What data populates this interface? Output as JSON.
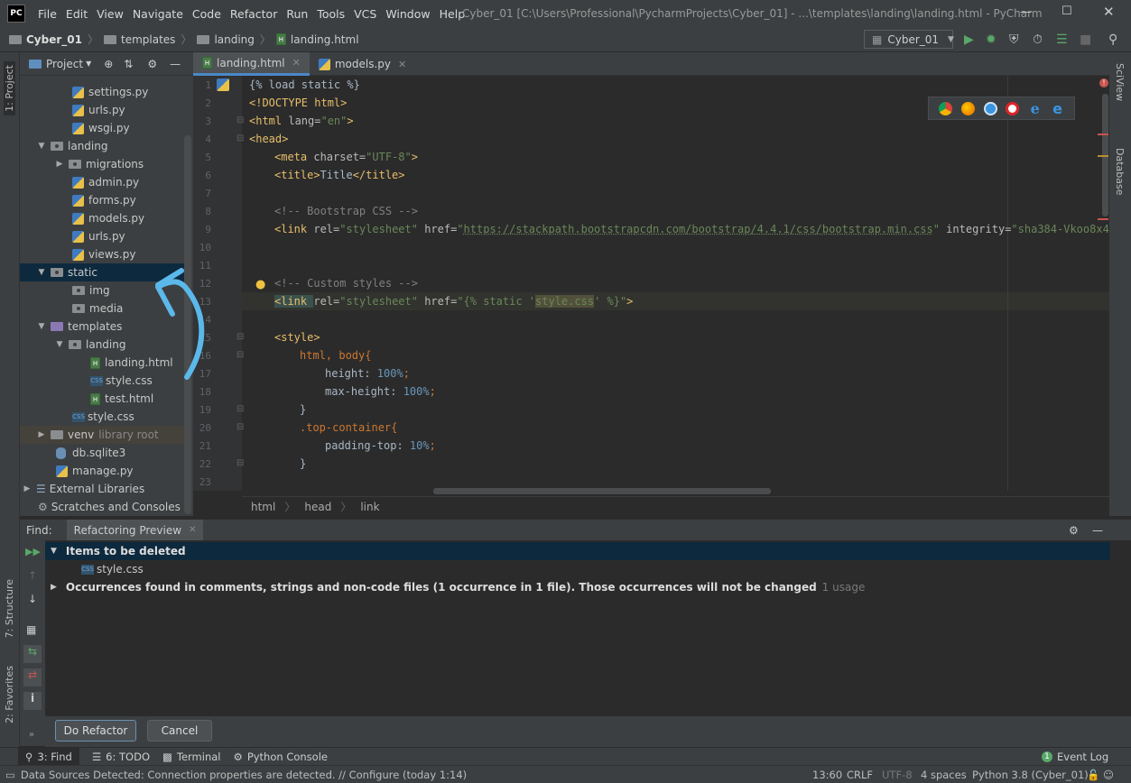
{
  "menu": {
    "logo": "PC",
    "items": [
      "File",
      "Edit",
      "View",
      "Navigate",
      "Code",
      "Refactor",
      "Run",
      "Tools",
      "VCS",
      "Window",
      "Help"
    ]
  },
  "window_title": "Cyber_01 [C:\\Users\\Professional\\PycharmProjects\\Cyber_01] - ...\\templates\\landing\\landing.html - PyCharm",
  "nav": {
    "breadcrumbs": [
      "Cyber_01",
      "templates",
      "landing",
      "landing.html"
    ],
    "run_config": "Cyber_01"
  },
  "left_tools": {
    "project": "1: Project",
    "structure": "7: Structure",
    "favorites": "2: Favorites"
  },
  "right_tools": {
    "sciview": "SciView",
    "database": "Database"
  },
  "project": {
    "header": "Project",
    "tree": [
      "settings.py",
      "urls.py",
      "wsgi.py",
      "landing",
      "migrations",
      "admin.py",
      "forms.py",
      "models.py",
      "urls.py",
      "views.py",
      "static",
      "img",
      "media",
      "templates",
      "landing",
      "landing.html",
      "style.css",
      "test.html",
      "style.css",
      "venv",
      "db.sqlite3",
      "manage.py",
      "External Libraries",
      "Scratches and Consoles"
    ],
    "venv_suffix": "library root"
  },
  "tabs": [
    "landing.html",
    "models.py"
  ],
  "code": {
    "line_numbers": [
      "1",
      "2",
      "3",
      "4",
      "5",
      "6",
      "7",
      "8",
      "9",
      "10",
      "11",
      "12",
      "13",
      "14",
      "15",
      "16",
      "17",
      "18",
      "19",
      "20",
      "21",
      "22",
      "23"
    ],
    "l1": "{% load static %}",
    "l2": "<!DOCTYPE html>",
    "l3a": "<html ",
    "l3b": "lang=",
    "l3c": "\"en\"",
    "l3d": ">",
    "l4": "<head>",
    "l5a": "<meta ",
    "l5b": "charset=",
    "l5c": "\"UTF-8\"",
    "l5d": ">",
    "l6a": "<title>",
    "l6b": "Title",
    "l6c": "</title>",
    "l8": "<!-- Bootstrap CSS -->",
    "l9a": "<link ",
    "l9b": "rel=",
    "l9c": "\"stylesheet\" ",
    "l9d": "href=",
    "l9e": "\"",
    "l9f": "https://stackpath.bootstrapcdn.com/bootstrap/4.4.1/css/bootstrap.min.css",
    "l9g": "\" ",
    "l9h": "integrity=",
    "l9i": "\"sha384-Vkoo8x4CGsO3",
    "l12": "<!-- Custom styles -->",
    "l13a": "<link ",
    "l13b": "rel=",
    "l13c": "\"stylesheet\" ",
    "l13d": "href=",
    "l13e": "\"{% static '",
    "l13f": "style.css",
    "l13g": "' %}\"",
    "l13h": ">",
    "l15": "<style>",
    "l16": "html, body{",
    "l17a": "height: ",
    "l17b": "100%",
    "l17c": ";",
    "l18a": "max-height: ",
    "l18b": "100%",
    "l18c": ";",
    "l19": "}",
    "l20": ".top-container{",
    "l21a": "padding-top: ",
    "l21b": "10%",
    "l21c": ";",
    "l22": "}"
  },
  "editor_breadcrumb": [
    "html",
    "head",
    "link"
  ],
  "find": {
    "label": "Find:",
    "tab": "Refactoring Preview",
    "rows": {
      "deleted": "Items to be deleted",
      "file": "style.css",
      "occ": "Occurrences found in comments, strings and non-code files  (1 occurrence in 1 file). Those occurrences will not be changed",
      "usage": "1 usage"
    },
    "do_refactor": "Do Refactor",
    "cancel": "Cancel"
  },
  "bottom_tabs": [
    "3: Find",
    "6: TODO",
    "Terminal",
    "Python Console"
  ],
  "event_log": "Event Log",
  "event_badge": "1",
  "status": {
    "message": "Data Sources Detected: Connection properties are detected. // Configure (today 1:14)",
    "position": "13:60",
    "line_sep": "CRLF",
    "encoding": "UTF-8",
    "indent": "4 spaces",
    "interpreter": "Python 3.8 (Cyber_01)"
  },
  "colors": {
    "accent": "#4a88c7",
    "selection": "#0d293e",
    "arrow": "#5bb8ea"
  }
}
